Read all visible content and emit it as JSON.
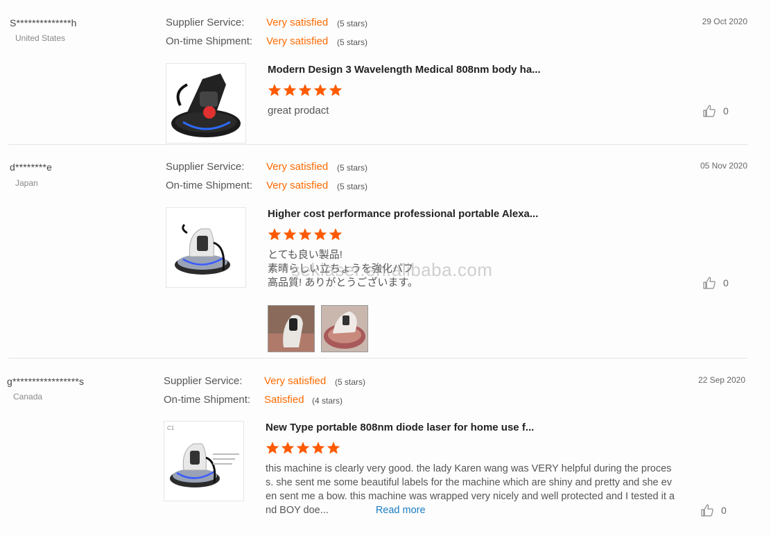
{
  "reviews": [
    {
      "buyer": "S**************h",
      "country": "United States",
      "supplier_label": "Supplier Service:",
      "supplier_value": "Very satisfied",
      "supplier_stars": "(5 stars)",
      "shipment_label": "On-time Shipment:",
      "shipment_value": "Very satisfied",
      "shipment_stars": "(5 stars)",
      "date": "29 Oct 2020",
      "product_title": "Modern Design 3 Wavelength Medical 808nm body ha...",
      "rating": 5,
      "text": "great prodact",
      "likes": "0"
    },
    {
      "buyer": "d********e",
      "country": "Japan",
      "supplier_label": "Supplier Service:",
      "supplier_value": "Very satisfied",
      "supplier_stars": "(5 stars)",
      "shipment_label": "On-time Shipment:",
      "shipment_value": "Very satisfied",
      "shipment_stars": "(5 stars)",
      "date": "05 Nov 2020",
      "product_title": "Higher cost performance professional portable Alexa...",
      "rating": 5,
      "text_lines": [
        "とても良い製品!",
        "素晴らしい立ちょうを強化パフ",
        "高品質! ありがとうございます。"
      ],
      "likes": "0"
    },
    {
      "buyer": "g*****************s",
      "country": "Canada",
      "supplier_label": "Supplier Service:",
      "supplier_value": "Very satisfied",
      "supplier_stars": "(5 stars)",
      "shipment_label": "On-time Shipment:",
      "shipment_value": "Satisfied",
      "shipment_stars": "(4 stars)",
      "date": "22 Sep 2020",
      "product_title": "New Type portable 808nm diode laser for home use f...",
      "rating": 5,
      "text_lines": [
        "this machine is clearly very good. the lady Karen wang was VERY helpful during the proces",
        "s. she sent me some beautiful labels for the machine which are shiny and pretty and she ev",
        "en sent me a bow. this machine was wrapped very nicely and well protected and I tested it a",
        "nd BOY doe..."
      ],
      "read_more": "Read more",
      "likes": "0"
    }
  ],
  "watermark": "sekiaser.en.alibaba.com",
  "colors": {
    "accent": "#ff6a00",
    "link": "#1a7bc1"
  },
  "icons": {
    "star": "star-icon",
    "like": "thumbs-up-icon"
  }
}
